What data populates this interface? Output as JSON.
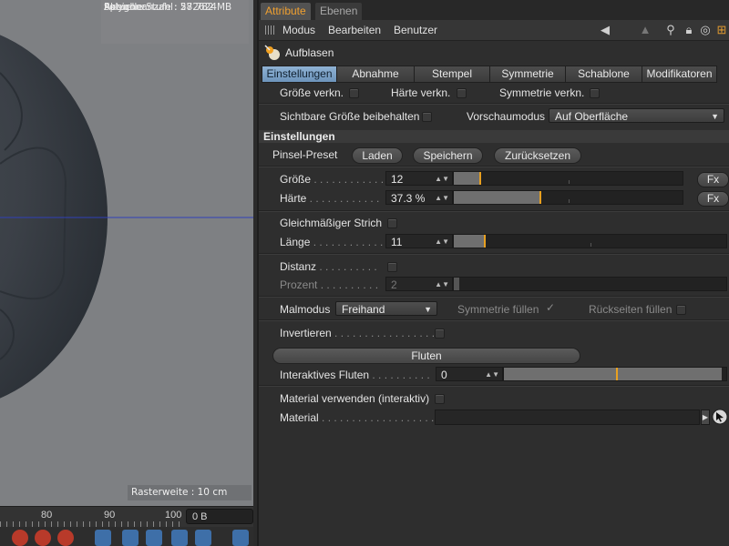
{
  "viewport": {
    "hud": [
      {
        "key": "Aktuelle Stufe",
        "value": ": 5"
      },
      {
        "key": "Polygonanzahl",
        "value": ": 282624"
      },
      {
        "key": "Speicher",
        "value": ": 57.782 MB"
      }
    ],
    "raster": "Rasterweite : 10 cm"
  },
  "timeline": {
    "ticks": [
      "80",
      "90",
      "100"
    ],
    "frame": "0 B"
  },
  "panel": {
    "tabs": {
      "active": "Attribute",
      "inactive": "Ebenen"
    },
    "menu": [
      "Modus",
      "Bearbeiten",
      "Benutzer"
    ],
    "toolbar_icons": [
      "arrow-left-icon",
      "arrow-up-icon",
      "search-icon",
      "lock-icon",
      "target-icon",
      "add-panel-icon"
    ],
    "object_name": "Aufblasen",
    "subtabs": [
      "Einstellungen",
      "Abnahme",
      "Stempel",
      "Symmetrie",
      "Schablone",
      "Modifikatoren"
    ],
    "subtab_selected": "Einstellungen",
    "link_row": {
      "size": "Größe verkn.",
      "hardness": "Härte verkn.",
      "symmetry": "Symmetrie verkn."
    },
    "visible_size": "Sichtbare Größe beibehalten",
    "preview_mode": {
      "label": "Vorschaumodus",
      "value": "Auf Oberfläche"
    },
    "section_title": "Einstellungen",
    "preset": {
      "label": "Pinsel-Preset",
      "load": "Laden",
      "save": "Speichern",
      "reset": "Zurücksetzen"
    },
    "size": {
      "label": "Größe",
      "dots": " . . . . . . . . . . . .",
      "value": "12",
      "fraction": 0.11,
      "fx": "Fx"
    },
    "hardness": {
      "label": "Härte",
      "dots": " . . . . . . . . . . . .",
      "value": "37.3 %",
      "fraction": 0.373,
      "fx": "Fx"
    },
    "even_stroke": "Gleichmäßiger Strich",
    "length": {
      "label": "Länge",
      "dots": " . . . . . . . . . . . .",
      "value": "11",
      "fraction": 0.11
    },
    "distance": {
      "label": "Distanz",
      "dots": " . . . . . . . . . ."
    },
    "percent": {
      "label": "Prozent",
      "dots": " . . . . . . . . . .",
      "value": "2",
      "fraction": 0.02
    },
    "paint_mode": {
      "label": "Malmodus",
      "value": "Freihand"
    },
    "symmetry_fill": "Symmetrie füllen",
    "back_fill": "Rückseiten füllen",
    "invert": {
      "label": "Invertieren",
      "dots": " . . . . . . . . . . . . . . . . ."
    },
    "flood_button": "Fluten",
    "interactive_flood": {
      "label": "Interaktives Fluten",
      "dots": " . . . . . . . . . .",
      "value": "0",
      "fraction": 0.98
    },
    "material_interactive": "Material verwenden (interaktiv)",
    "material": {
      "label": "Material",
      "dots": " . . . . . . . . . . . . . . . . . . . . . . ."
    }
  }
}
